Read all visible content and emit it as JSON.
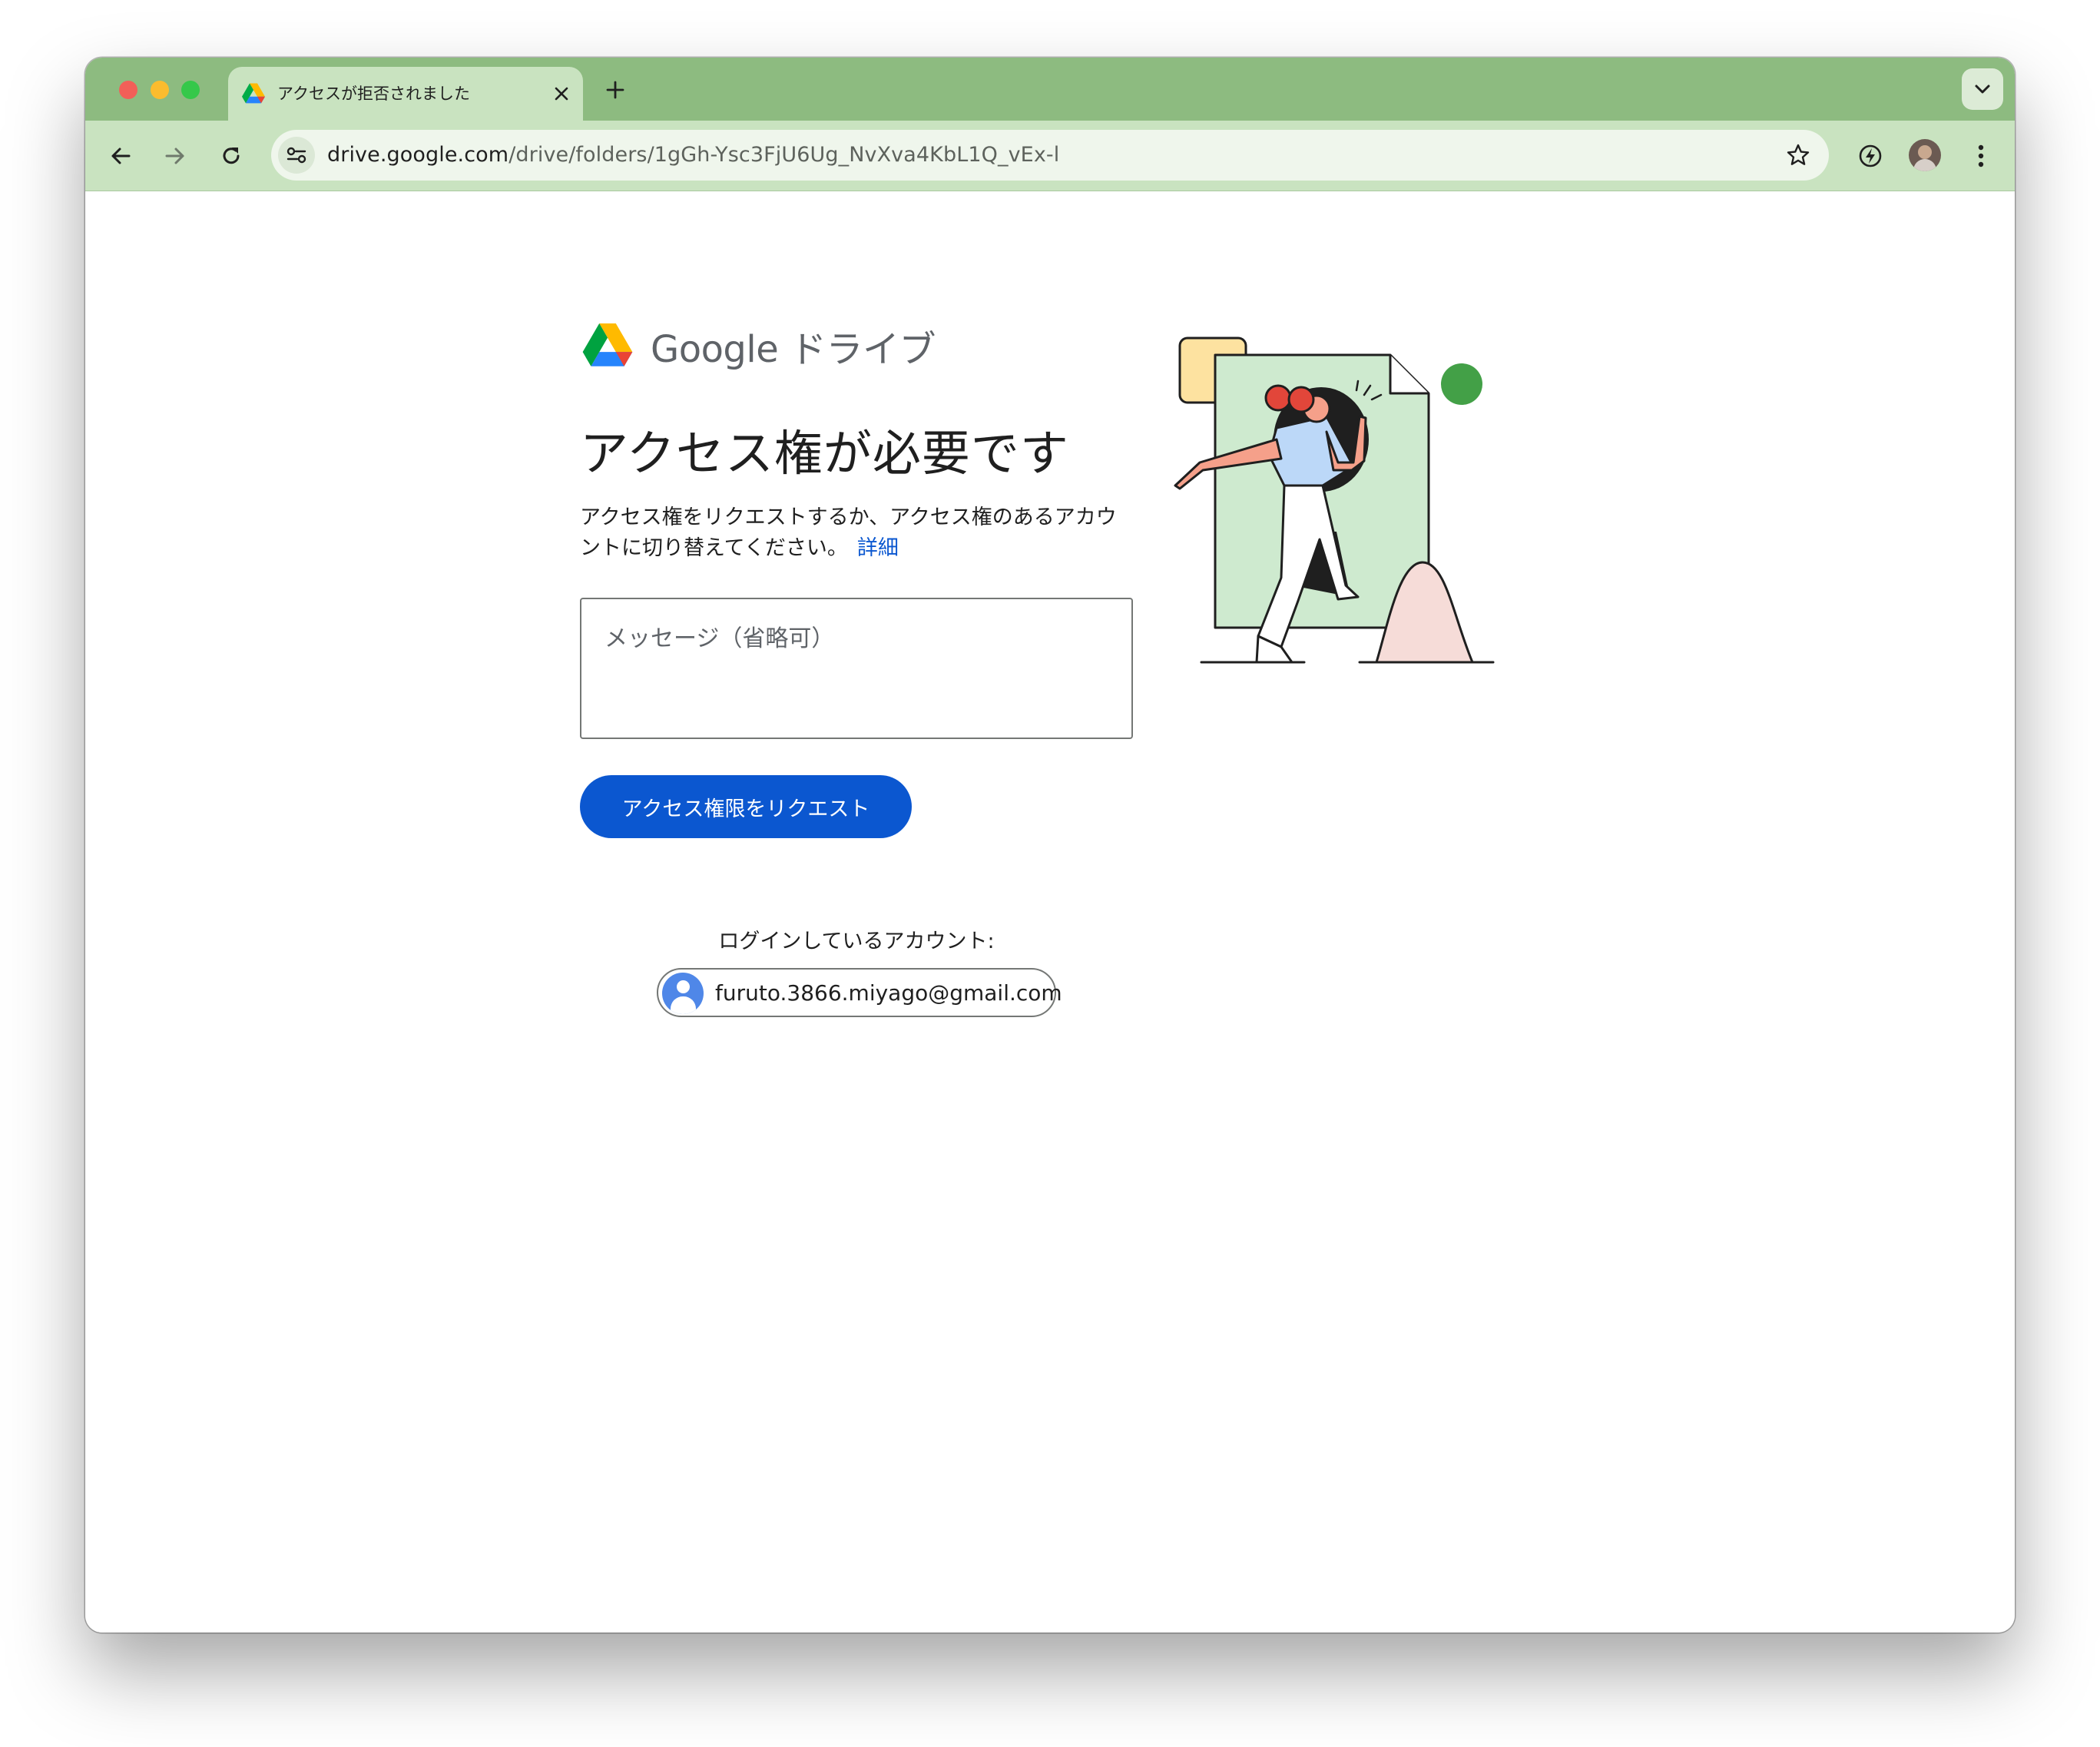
{
  "browser": {
    "tab_title": "アクセスが拒否されました",
    "url_host": "drive.google.com",
    "url_path": "/drive/folders/1gGh-Ysc3FjU6Ug_NvXva4KbL1Q_vEx-l"
  },
  "page": {
    "brand": "Google ドライブ",
    "heading": "アクセス権が必要です",
    "description": "アクセス権をリクエストするか、アクセス権のあるアカウントに切り替えてください。",
    "learn_more": "詳細",
    "message_placeholder": "メッセージ（省略可）",
    "request_button": "アクセス権限をリクエスト",
    "login_label": "ログインしているアカウント:",
    "account_email": "furuto.3866.miyago@gmail.com"
  },
  "icons": {
    "tab_favicon": "google-drive-icon",
    "tab_close": "close-icon",
    "new_tab": "plus-icon",
    "tab_search": "chevron-down-icon",
    "back": "arrow-left-icon",
    "forward": "arrow-right-icon",
    "reload": "reload-icon",
    "site_info": "tune-icon",
    "bookmark": "star-icon",
    "extension": "lightning-icon",
    "profile": "avatar-icon",
    "menu": "more-vert-icon"
  },
  "colors": {
    "tabstrip": "#8dbb80",
    "toolbar": "#c9e3c0",
    "primary_button": "#0b57d0",
    "link": "#0b57d0"
  }
}
